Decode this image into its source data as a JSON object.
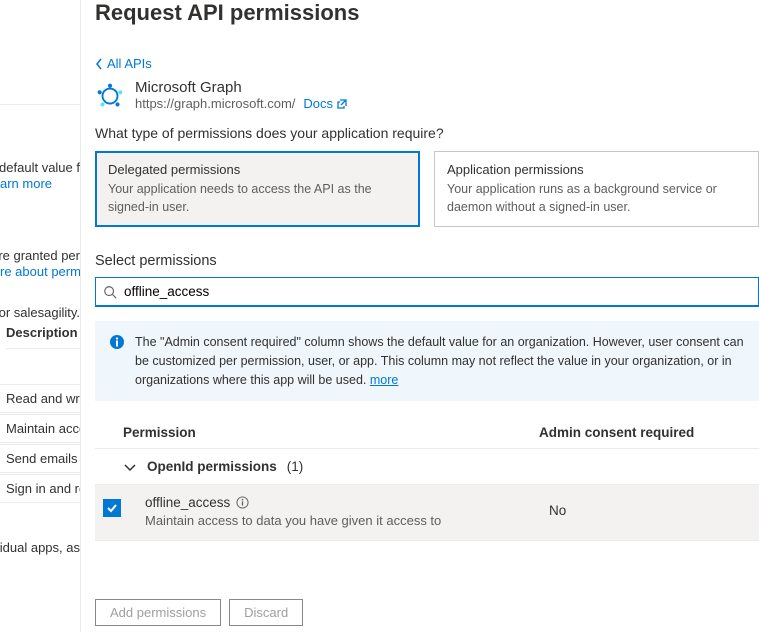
{
  "bg": {
    "default_value_text": "e default value f",
    "learn_more": "arn more",
    "granted_text": "re granted per",
    "about_perm": "re about permi",
    "sales_text": "for salesagility.",
    "desc_header": "Description",
    "row1": "Read and writ",
    "row2": "Maintain acce",
    "row3": "Send emails f",
    "row4": "Sign in and re",
    "apps_text": "vidual apps, as"
  },
  "panel": {
    "title": "Request API permissions",
    "back_link": "All APIs",
    "api_name": "Microsoft Graph",
    "api_url": "https://graph.microsoft.com/",
    "docs_label": "Docs",
    "question": "What type of permissions does your application require?",
    "delegated": {
      "title": "Delegated permissions",
      "desc": "Your application needs to access the API as the signed-in user."
    },
    "application": {
      "title": "Application permissions",
      "desc": "Your application runs as a background service or daemon without a signed-in user."
    },
    "select_label": "Select permissions",
    "search_value": "offline_access",
    "info_text": "The \"Admin consent required\" column shows the default value for an organization. However, user consent can be customized per permission, user, or app. This column may not reflect the value in your organization, or in organizations where this app will be used.",
    "info_more": "more",
    "columns": {
      "permission": "Permission",
      "admin": "Admin consent required"
    },
    "group": {
      "label": "OpenId permissions",
      "count": "(1)"
    },
    "perm": {
      "name": "offline_access",
      "desc": "Maintain access to data you have given it access to",
      "admin": "No"
    },
    "buttons": {
      "add": "Add permissions",
      "discard": "Discard"
    }
  }
}
